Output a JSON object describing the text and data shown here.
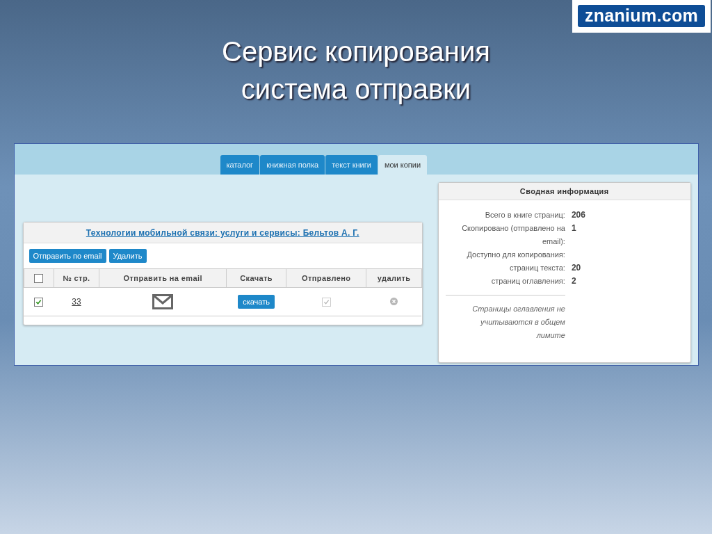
{
  "logo": {
    "text": "znanium.com"
  },
  "slide_title": [
    "Сервис копирования",
    "система отправки"
  ],
  "tabs": [
    {
      "label": "каталог",
      "selected": false
    },
    {
      "label": "книжная полка",
      "selected": false
    },
    {
      "label": "текст книги",
      "selected": false
    },
    {
      "label": "мои копии",
      "selected": true
    }
  ],
  "copies_card": {
    "book_title": "Технологии мобильной связи: услуги и сервисы: Бельтов А. Г.",
    "buttons": [
      "Отправить по email",
      "Удалить"
    ],
    "select_all_checked": false,
    "columns": [
      "№ стр.",
      "Отправить на email",
      "Скачать",
      "Отправлено",
      "удалить"
    ],
    "rows": [
      {
        "checked": true,
        "page": "33",
        "download": "скачать",
        "sent": true
      }
    ]
  },
  "summary": {
    "title": "Сводная информация",
    "rows": [
      {
        "label": "Всего в книге страниц:",
        "value": "206"
      },
      {
        "label": "Скопировано (отправлено на email):",
        "value": "1"
      },
      {
        "label": "Доступно для копирования:"
      },
      {
        "label": "страниц текста:",
        "value": "20"
      },
      {
        "label": "страниц оглавления:",
        "value": "2"
      }
    ],
    "note": "Страницы оглавления не учитываются в общем лимите"
  }
}
